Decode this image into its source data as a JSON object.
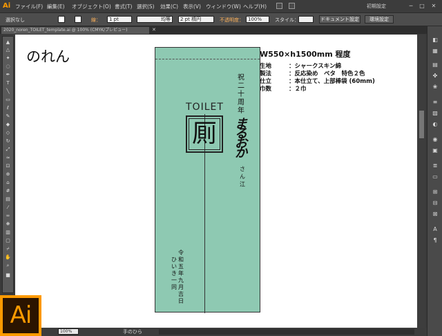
{
  "app": {
    "logo": "Ai",
    "badge": "Ai"
  },
  "menubar": {
    "items": [
      "ファイル(F)",
      "編集(E)",
      "オブジェクト(O)",
      "書式(T)",
      "選択(S)",
      "効果(C)",
      "表示(V)",
      "ウィンドウ(W)",
      "ヘルプ(H)"
    ],
    "workspace": "初期設定",
    "window_buttons": [
      "─",
      "□",
      "✕"
    ]
  },
  "controlbar": {
    "selection": "選択なし",
    "stroke_label": "線：",
    "stroke_weight": "1 pt",
    "profile": "均等",
    "brush": "2 pt 楕円",
    "opacity_label": "不透明度：",
    "opacity": "100%",
    "style_label": "スタイル：",
    "doc_setup": "ドキュメント設定",
    "preferences": "環境設定"
  },
  "document_tab": {
    "label": "2020_noren_TOILET_template.ai @ 100% (CMYK/プレビュー)",
    "close": "✕"
  },
  "statusbar": {
    "zoom": "100%",
    "tool": "手のひら"
  },
  "artboard": {
    "title": "のれん",
    "noren": {
      "celebration": "祝二十周年",
      "toilet": "TOILET",
      "kanji": "厠",
      "shop_name": "まるおか",
      "recipient": "さん江",
      "date_cols": [
        "令和五年九月吉日",
        "ひいき一同"
      ]
    },
    "specs": {
      "size": "W550×h1500mm 程度",
      "rows": [
        {
          "key": "生地",
          "value": "：シャークスキン綿"
        },
        {
          "key": "製法",
          "value": "：反応染め　ベタ　特色２色"
        },
        {
          "key": "仕立",
          "value": "：本仕立て、上部棒袋 (60mm)"
        },
        {
          "key": "巾数",
          "value": "：２巾"
        }
      ]
    }
  },
  "colors": {
    "noren_fill": "#8ec9b2",
    "accent": "#ff9a00",
    "ui_dark": "#3c3c3c"
  }
}
